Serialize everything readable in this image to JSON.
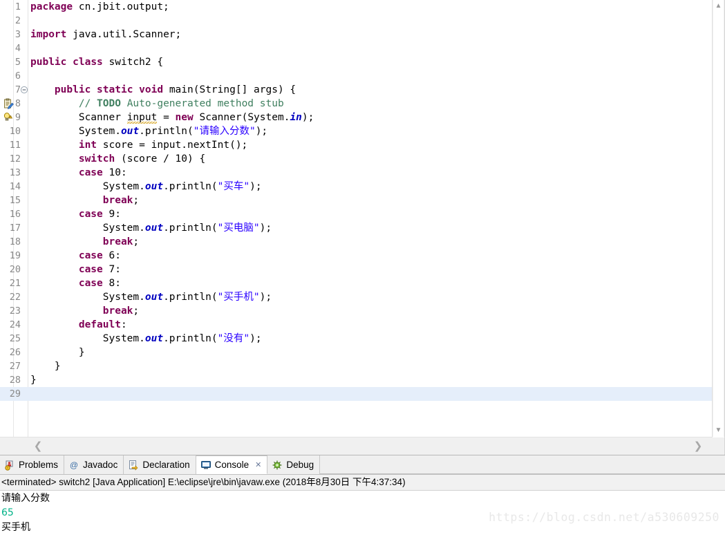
{
  "editor": {
    "language": "java",
    "current_line": 29,
    "lines": [
      {
        "n": 1,
        "tokens": [
          {
            "t": "package",
            "c": "kw"
          },
          {
            "t": " cn.jbit.output;",
            "c": "plain"
          }
        ]
      },
      {
        "n": 2,
        "tokens": []
      },
      {
        "n": 3,
        "tokens": [
          {
            "t": "import",
            "c": "kw"
          },
          {
            "t": " java.util.Scanner;",
            "c": "plain"
          }
        ]
      },
      {
        "n": 4,
        "tokens": []
      },
      {
        "n": 5,
        "tokens": [
          {
            "t": "public",
            "c": "kw"
          },
          {
            "t": " ",
            "c": "plain"
          },
          {
            "t": "class",
            "c": "kw"
          },
          {
            "t": " switch2 {",
            "c": "plain"
          }
        ]
      },
      {
        "n": 6,
        "tokens": []
      },
      {
        "n": 7,
        "fold": "collapse",
        "tokens": [
          {
            "t": "    ",
            "c": "plain"
          },
          {
            "t": "public",
            "c": "kw"
          },
          {
            "t": " ",
            "c": "plain"
          },
          {
            "t": "static",
            "c": "kw"
          },
          {
            "t": " ",
            "c": "plain"
          },
          {
            "t": "void",
            "c": "kw"
          },
          {
            "t": " main(String[] args) {",
            "c": "plain"
          }
        ]
      },
      {
        "n": 8,
        "marker": "todo-icon",
        "tokens": [
          {
            "t": "        ",
            "c": "plain"
          },
          {
            "t": "// ",
            "c": "cmt"
          },
          {
            "t": "TODO",
            "c": "todo"
          },
          {
            "t": " Auto-generated method stub",
            "c": "cmt"
          }
        ]
      },
      {
        "n": 9,
        "marker": "warning-icon",
        "tokens": [
          {
            "t": "        Scanner ",
            "c": "plain"
          },
          {
            "t": "input",
            "c": "plain",
            "warn": true
          },
          {
            "t": " = ",
            "c": "plain"
          },
          {
            "t": "new",
            "c": "kw"
          },
          {
            "t": " Scanner(System.",
            "c": "plain"
          },
          {
            "t": "in",
            "c": "fld"
          },
          {
            "t": ");",
            "c": "plain"
          }
        ]
      },
      {
        "n": 10,
        "tokens": [
          {
            "t": "        System.",
            "c": "plain"
          },
          {
            "t": "out",
            "c": "fld"
          },
          {
            "t": ".println(",
            "c": "plain"
          },
          {
            "t": "\"请输入分数\"",
            "c": "str"
          },
          {
            "t": ");",
            "c": "plain"
          }
        ]
      },
      {
        "n": 11,
        "tokens": [
          {
            "t": "        ",
            "c": "plain"
          },
          {
            "t": "int",
            "c": "kw"
          },
          {
            "t": " score = input.nextInt();",
            "c": "plain"
          }
        ]
      },
      {
        "n": 12,
        "tokens": [
          {
            "t": "        ",
            "c": "plain"
          },
          {
            "t": "switch",
            "c": "kw"
          },
          {
            "t": " (score / 10) {",
            "c": "plain"
          }
        ]
      },
      {
        "n": 13,
        "tokens": [
          {
            "t": "        ",
            "c": "plain"
          },
          {
            "t": "case",
            "c": "kw"
          },
          {
            "t": " 10:",
            "c": "plain"
          }
        ]
      },
      {
        "n": 14,
        "tokens": [
          {
            "t": "            System.",
            "c": "plain"
          },
          {
            "t": "out",
            "c": "fld"
          },
          {
            "t": ".println(",
            "c": "plain"
          },
          {
            "t": "\"买车\"",
            "c": "str"
          },
          {
            "t": ");",
            "c": "plain"
          }
        ]
      },
      {
        "n": 15,
        "tokens": [
          {
            "t": "            ",
            "c": "plain"
          },
          {
            "t": "break",
            "c": "kw"
          },
          {
            "t": ";",
            "c": "plain"
          }
        ]
      },
      {
        "n": 16,
        "tokens": [
          {
            "t": "        ",
            "c": "plain"
          },
          {
            "t": "case",
            "c": "kw"
          },
          {
            "t": " 9:",
            "c": "plain"
          }
        ]
      },
      {
        "n": 17,
        "tokens": [
          {
            "t": "            System.",
            "c": "plain"
          },
          {
            "t": "out",
            "c": "fld"
          },
          {
            "t": ".println(",
            "c": "plain"
          },
          {
            "t": "\"买电脑\"",
            "c": "str"
          },
          {
            "t": ");",
            "c": "plain"
          }
        ]
      },
      {
        "n": 18,
        "tokens": [
          {
            "t": "            ",
            "c": "plain"
          },
          {
            "t": "break",
            "c": "kw"
          },
          {
            "t": ";",
            "c": "plain"
          }
        ]
      },
      {
        "n": 19,
        "tokens": [
          {
            "t": "        ",
            "c": "plain"
          },
          {
            "t": "case",
            "c": "kw"
          },
          {
            "t": " 6:",
            "c": "plain"
          }
        ]
      },
      {
        "n": 20,
        "tokens": [
          {
            "t": "        ",
            "c": "plain"
          },
          {
            "t": "case",
            "c": "kw"
          },
          {
            "t": " 7:",
            "c": "plain"
          }
        ]
      },
      {
        "n": 21,
        "tokens": [
          {
            "t": "        ",
            "c": "plain"
          },
          {
            "t": "case",
            "c": "kw"
          },
          {
            "t": " 8:",
            "c": "plain"
          }
        ]
      },
      {
        "n": 22,
        "tokens": [
          {
            "t": "            System.",
            "c": "plain"
          },
          {
            "t": "out",
            "c": "fld"
          },
          {
            "t": ".println(",
            "c": "plain"
          },
          {
            "t": "\"买手机\"",
            "c": "str"
          },
          {
            "t": ");",
            "c": "plain"
          }
        ]
      },
      {
        "n": 23,
        "tokens": [
          {
            "t": "            ",
            "c": "plain"
          },
          {
            "t": "break",
            "c": "kw"
          },
          {
            "t": ";",
            "c": "plain"
          }
        ]
      },
      {
        "n": 24,
        "tokens": [
          {
            "t": "        ",
            "c": "plain"
          },
          {
            "t": "default",
            "c": "kw"
          },
          {
            "t": ":",
            "c": "plain"
          }
        ]
      },
      {
        "n": 25,
        "tokens": [
          {
            "t": "            System.",
            "c": "plain"
          },
          {
            "t": "out",
            "c": "fld"
          },
          {
            "t": ".println(",
            "c": "plain"
          },
          {
            "t": "\"没有\"",
            "c": "str"
          },
          {
            "t": ");",
            "c": "plain"
          }
        ]
      },
      {
        "n": 26,
        "tokens": [
          {
            "t": "        }",
            "c": "plain"
          }
        ]
      },
      {
        "n": 27,
        "tokens": [
          {
            "t": "    }",
            "c": "plain"
          }
        ]
      },
      {
        "n": 28,
        "tokens": [
          {
            "t": "}",
            "c": "plain"
          }
        ]
      },
      {
        "n": 29,
        "tokens": []
      }
    ],
    "scroll": {
      "up_arrow": "▲",
      "down_arrow": "▼",
      "left_arrow": "❮",
      "right_arrow": "❯"
    }
  },
  "bottom_panel": {
    "tabs": [
      {
        "label": "Problems",
        "icon": "problems-icon",
        "active": false,
        "closable": false
      },
      {
        "label": "Javadoc",
        "icon": "javadoc-icon",
        "active": false,
        "closable": false
      },
      {
        "label": "Declaration",
        "icon": "declaration-icon",
        "active": false,
        "closable": false
      },
      {
        "label": "Console",
        "icon": "console-icon",
        "active": true,
        "closable": true
      },
      {
        "label": "Debug",
        "icon": "debug-icon",
        "active": false,
        "closable": false
      }
    ],
    "close_glyph": "✕",
    "console": {
      "header": "<terminated> switch2 [Java Application] E:\\eclipse\\jre\\bin\\javaw.exe (2018年8月30日 下午4:37:34)",
      "output": [
        {
          "text": "请输入分数",
          "kind": "out"
        },
        {
          "text": "65",
          "kind": "in"
        },
        {
          "text": "买手机",
          "kind": "out"
        }
      ]
    }
  },
  "watermark": {
    "text": "https://blog.csdn.net/a530609250"
  },
  "colors": {
    "keyword": "#7f0055",
    "string": "#2a00ff",
    "comment": "#3f7f5f",
    "field": "#0000c0",
    "current_line": "#e5eefa",
    "console_input": "#00b287",
    "warning_underline": "#d4a017"
  }
}
